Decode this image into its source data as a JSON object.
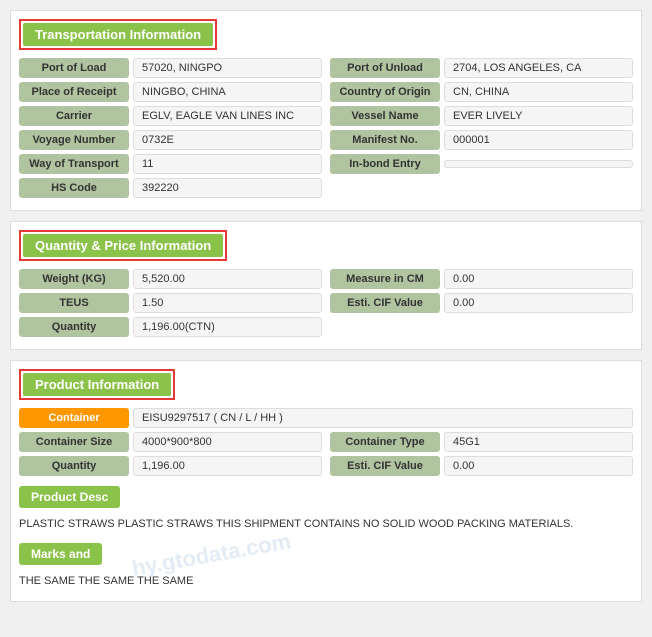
{
  "transportation": {
    "header": "Transportation Information",
    "fields": [
      {
        "label": "Port of Load",
        "value": "57020, NINGPO",
        "label2": "Port of Unload",
        "value2": "2704, LOS ANGELES, CA"
      },
      {
        "label": "Place of Receipt",
        "value": "NINGBO, CHINA",
        "label2": "Country of Origin",
        "value2": "CN, CHINA"
      },
      {
        "label": "Carrier",
        "value": "EGLV, EAGLE VAN LINES INC",
        "label2": "Vessel Name",
        "value2": "EVER LIVELY"
      },
      {
        "label": "Voyage Number",
        "value": "0732E",
        "label2": "Manifest No.",
        "value2": "000001"
      },
      {
        "label": "Way of Transport",
        "value": "11",
        "label2": "In-bond Entry",
        "value2": ""
      },
      {
        "label": "HS Code",
        "value": "392220",
        "label2": "",
        "value2": ""
      }
    ]
  },
  "quantity": {
    "header": "Quantity & Price Information",
    "fields": [
      {
        "label": "Weight (KG)",
        "value": "5,520.00",
        "label2": "Measure in CM",
        "value2": "0.00"
      },
      {
        "label": "TEUS",
        "value": "1.50",
        "label2": "Esti. CIF Value",
        "value2": "0.00"
      },
      {
        "label": "Quantity",
        "value": "1,196.00(CTN)",
        "label2": "",
        "value2": ""
      }
    ]
  },
  "product": {
    "header": "Product Information",
    "container_label": "Container",
    "container_value": "EISU9297517 ( CN / L / HH )",
    "fields": [
      {
        "label": "Container Size",
        "value": "4000*900*800",
        "label2": "Container Type",
        "value2": "45G1"
      },
      {
        "label": "Quantity",
        "value": "1,196.00",
        "label2": "Esti. CIF Value",
        "value2": "0.00"
      }
    ],
    "product_desc_header": "Product Desc",
    "product_desc": "PLASTIC STRAWS PLASTIC STRAWS THIS SHIPMENT CONTAINS NO SOLID WOOD PACKING MATERIALS.",
    "marks_header": "Marks and",
    "marks_text": "THE SAME THE SAME THE SAME"
  },
  "watermark": "hy.gtodata.com"
}
